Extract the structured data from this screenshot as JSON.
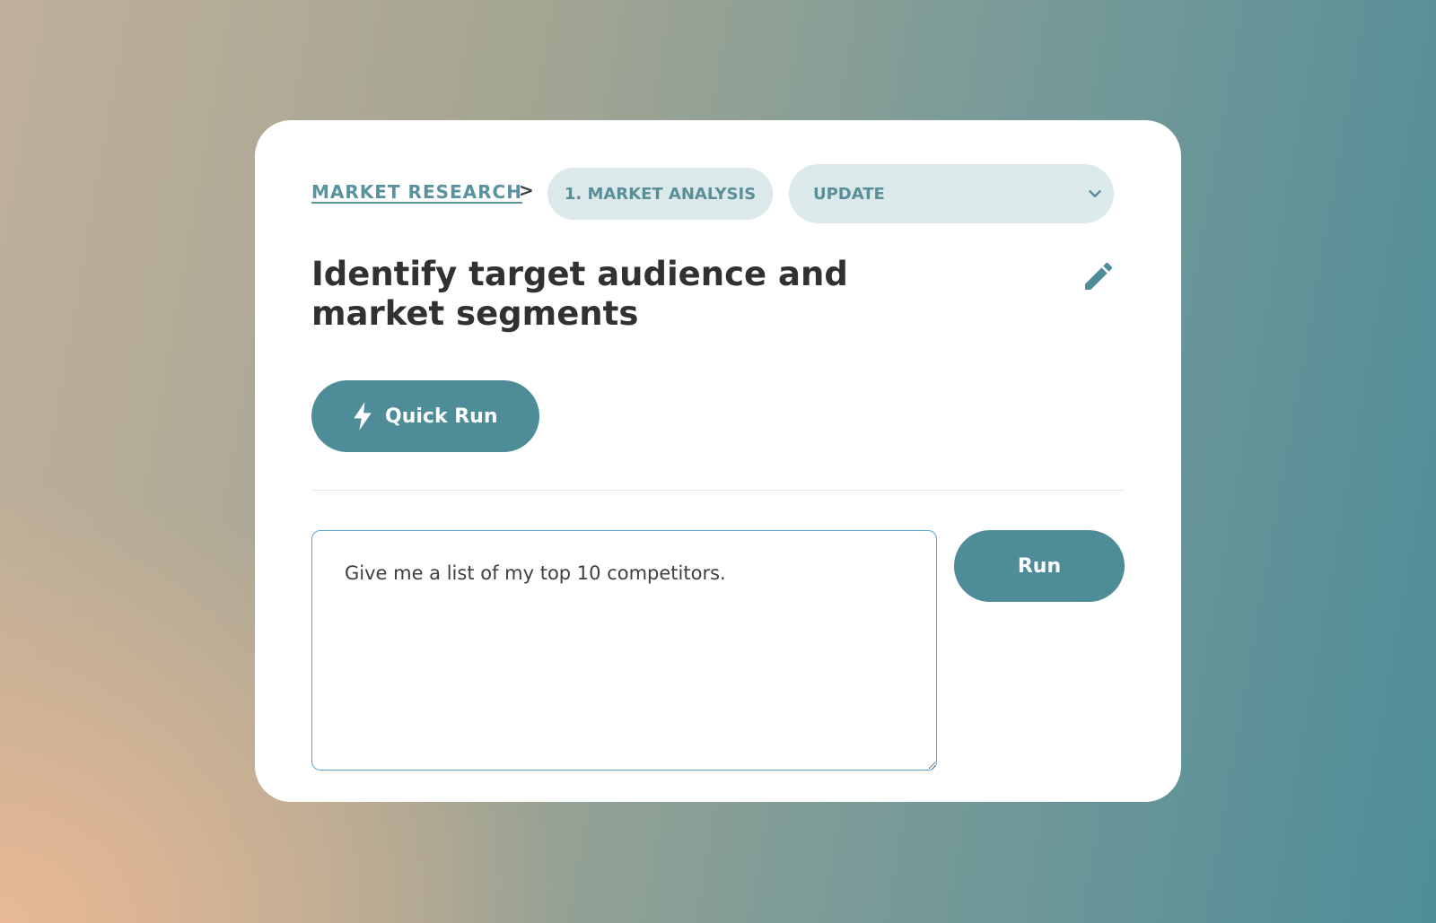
{
  "breadcrumb": {
    "parent_label": "MARKET RESEARCH",
    "separator": ">",
    "step_label": "1. MARKET ANALYSIS",
    "select_value": "UPDATE",
    "select_icon": "chevron-down-icon"
  },
  "header": {
    "title": "Identify target audience and market segments",
    "edit_icon": "pencil-icon"
  },
  "actions": {
    "quick_run_label": "Quick Run",
    "quick_run_icon": "lightning-bolt-icon",
    "run_label": "Run"
  },
  "prompt": {
    "value": "Give me a list of my top 10 competitors."
  },
  "colors": {
    "accent": "#4e8c98",
    "pill_bg": "#dce9ea",
    "link": "#5a93a0",
    "title": "#2f3133",
    "focus_border": "#5aa4d8"
  }
}
